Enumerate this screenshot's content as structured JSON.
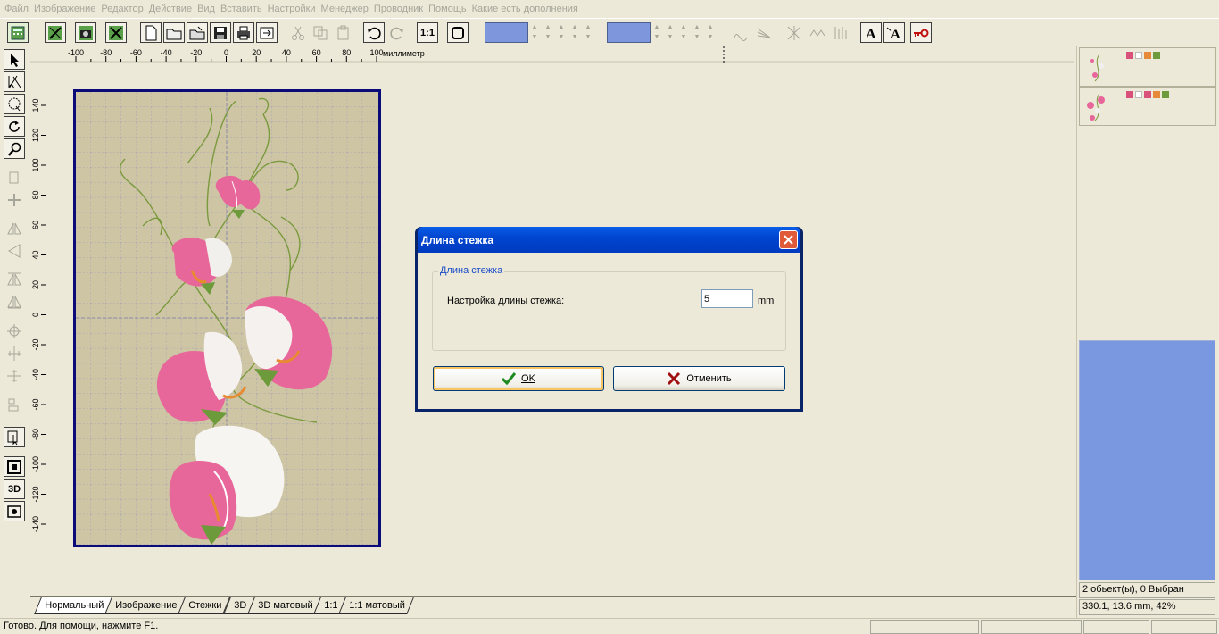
{
  "menu": [
    "Файл",
    "Изображение",
    "Редактор",
    "Действие",
    "Вид",
    "Вставить",
    "Настройки",
    "Менеджер",
    "Проводник",
    "Помощь",
    "Какие есть дополнения"
  ],
  "ruler": {
    "unit": "миллиметр",
    "h_ticks": [
      "-100",
      "-80",
      "-60",
      "-40",
      "-20",
      "0",
      "20",
      "40",
      "60",
      "80",
      "100"
    ],
    "v_ticks": [
      "140",
      "120",
      "100",
      "80",
      "60",
      "40",
      "20",
      "0",
      "-20",
      "-40",
      "-60",
      "-80",
      "-100",
      "-120",
      "-140"
    ]
  },
  "tabs": [
    "Нормальный",
    "Изображение",
    "Стежки",
    "3D",
    "3D матовый",
    "1:1",
    "1:1 матовый"
  ],
  "status": {
    "text": "Готово. Для помощи, нажмите F1."
  },
  "info": {
    "objects": "2 обьект(ы), 0 Выбран",
    "coords": "330.1, 13.6 mm, 42%"
  },
  "colors": {
    "swatch1": "#7d96dc",
    "swatch2": "#7d96dc",
    "panel": "#7a98e0",
    "thumb1_chips": [
      "#d9507a",
      "#ffffff",
      "#e68a3a",
      "#6d9a3a"
    ],
    "thumb2_chips": [
      "#d9507a",
      "#ffffff",
      "#d9507a",
      "#e68a3a",
      "#6d9a3a"
    ],
    "fabric": "#cec5a4",
    "frame": "#0a0a78",
    "petal": "#e8679a",
    "leaf": "#7a9a3e"
  },
  "toolbar": {
    "zoom_label": "1:1"
  },
  "left_toolbar": {
    "view3d_label": "3D"
  },
  "dialog": {
    "title": "Длина стежка",
    "group_label": "Длина стежка",
    "field_label": "Настройка длины стежка:",
    "value": "5",
    "unit": "mm",
    "ok_label": "OK",
    "cancel_label": "Отменить"
  }
}
